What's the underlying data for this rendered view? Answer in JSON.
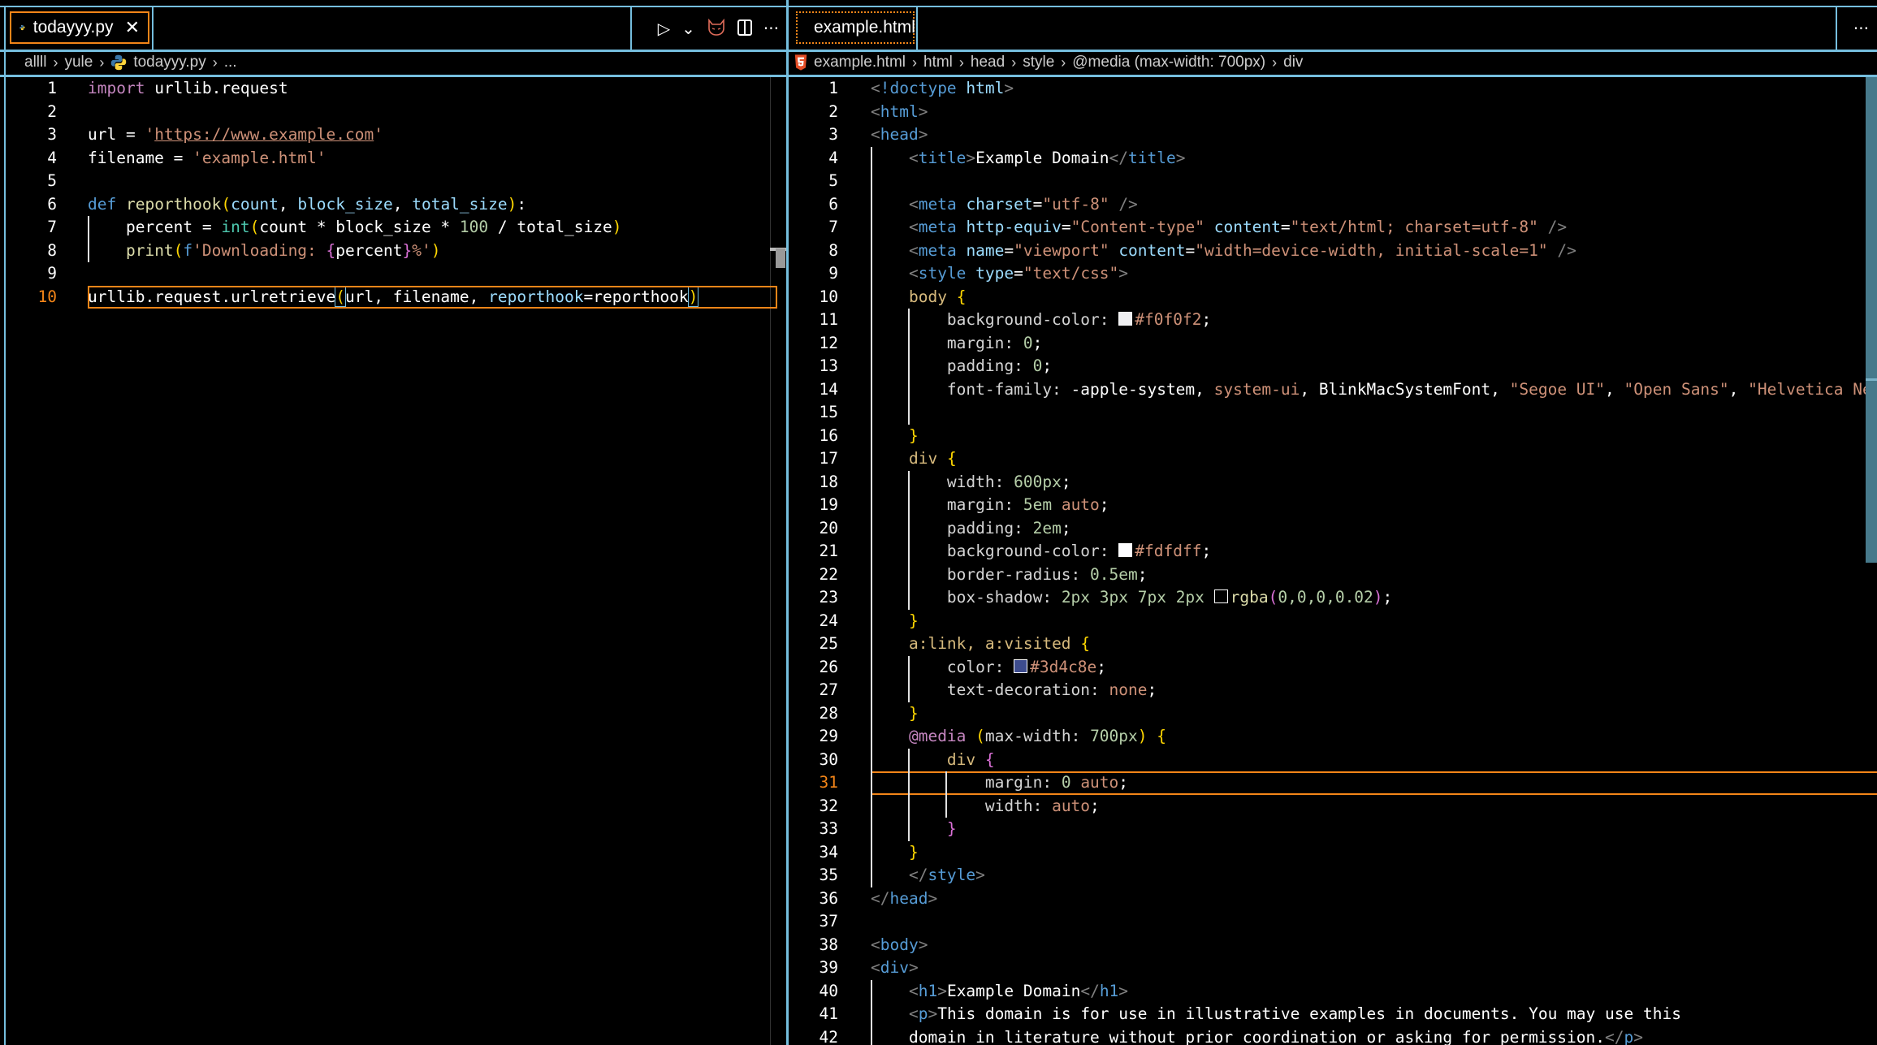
{
  "left": {
    "tab": {
      "label": "todayyy.py",
      "icon": "python-icon",
      "close": "✕"
    },
    "actions": [
      {
        "name": "run-button",
        "glyph": "▷"
      },
      {
        "name": "run-dropdown-button",
        "glyph": "⌄"
      },
      {
        "name": "copilot-button",
        "glyph": "🐱"
      },
      {
        "name": "split-editor-button",
        "glyph": "◫"
      },
      {
        "name": "more-actions-button",
        "glyph": "···"
      }
    ],
    "breadcrumb": [
      "allll",
      "yule",
      "todayyy.py",
      "..."
    ],
    "current_line": 10,
    "lines": [
      {
        "n": "1",
        "html": "<span class='kw'>import</span> <span class='w'>urllib.request</span>"
      },
      {
        "n": "2",
        "html": ""
      },
      {
        "n": "3",
        "html": "<span class='w'>url = </span><span class='str'>'<span class='u'>https://www.example.com</span>'</span>"
      },
      {
        "n": "4",
        "html": "<span class='w'>filename = </span><span class='str'>'example.html'</span>"
      },
      {
        "n": "5",
        "html": ""
      },
      {
        "n": "6",
        "html": "<span class='kb'>def</span> <span class='fn'>reporthook</span><span class='bl'>(</span><span class='var'>count</span>, <span class='var'>block_size</span>, <span class='var'>total_size</span><span class='bl'>)</span>:"
      },
      {
        "n": "7",
        "html": "    <span class='w'>percent = </span><span class='bi'>int</span><span class='bl'>(</span><span class='w'>count * block_size * </span><span class='num'>100</span><span class='w'> / total_size</span><span class='bl'>)</span>"
      },
      {
        "n": "8",
        "html": "    <span class='fn'>print</span><span class='bl'>(</span><span class='kb'>f</span><span class='str'>'Downloading: </span><span class='bp'>{</span><span class='w'>percent</span><span class='bp'>}</span><span class='str'>%'</span><span class='bl'>)</span>"
      },
      {
        "n": "9",
        "html": ""
      },
      {
        "n": "10",
        "html": "<span class='w'>urllib.request.urlretrieve</span><span class='bl bmatch'>(</span><span class='w'>url, filename, </span><span class='var'>reporthook</span><span class='w'>=reporthook</span><span class='bl bmatch'>)</span>"
      }
    ]
  },
  "right": {
    "tab": {
      "label": "example.html",
      "icon": "html5-icon",
      "dirty": true
    },
    "actions": [
      {
        "name": "more-actions-button",
        "glyph": "···"
      }
    ],
    "breadcrumb": [
      "example.html",
      "html",
      "head",
      "style",
      "@media (max-width: 700px)",
      "div"
    ],
    "current_line": 31,
    "lines": [
      {
        "n": "1",
        "html": "<span class='ang'>&lt;</span><span class='tag'>!doctype</span> <span class='attr'>html</span><span class='ang'>&gt;</span>"
      },
      {
        "n": "2",
        "html": "<span class='ang'>&lt;</span><span class='tag'>html</span><span class='ang'>&gt;</span>"
      },
      {
        "n": "3",
        "html": "<span class='ang'>&lt;</span><span class='tag'>head</span><span class='ang'>&gt;</span>"
      },
      {
        "n": "4",
        "html": "    <span class='ang'>&lt;</span><span class='tag'>title</span><span class='ang'>&gt;</span><span class='w'>Example Domain</span><span class='ang'>&lt;/</span><span class='tag'>title</span><span class='ang'>&gt;</span>"
      },
      {
        "n": "5",
        "html": ""
      },
      {
        "n": "6",
        "html": "    <span class='ang'>&lt;</span><span class='tag'>meta</span> <span class='attr'>charset</span>=<span class='str'>\"utf-8\"</span> <span class='ang'>/&gt;</span>"
      },
      {
        "n": "7",
        "html": "    <span class='ang'>&lt;</span><span class='tag'>meta</span> <span class='attr'>http-equiv</span>=<span class='str'>\"Content-type\"</span> <span class='attr'>content</span>=<span class='str'>\"text/html; charset=utf-8\"</span> <span class='ang'>/&gt;</span>"
      },
      {
        "n": "8",
        "html": "    <span class='ang'>&lt;</span><span class='tag'>meta</span> <span class='attr'>name</span>=<span class='str'>\"viewport\"</span> <span class='attr'>content</span>=<span class='str'>\"width=device-width, initial-scale=1\"</span> <span class='ang'>/&gt;</span>"
      },
      {
        "n": "9",
        "html": "    <span class='ang'>&lt;</span><span class='tag'>style</span> <span class='attr'>type</span>=<span class='str'>\"text/css\"</span><span class='ang'>&gt;</span>"
      },
      {
        "n": "10",
        "html": "    <span class='sel'>body</span> <span class='bl'>{</span>"
      },
      {
        "n": "11",
        "html": "        <span class='prop'>background-color: </span><span class='sw' style='background:#f0f0f2'></span><span class='str'>#f0f0f2</span>;"
      },
      {
        "n": "12",
        "html": "        <span class='prop'>margin: </span><span class='num'>0</span>;"
      },
      {
        "n": "13",
        "html": "        <span class='prop'>padding: </span><span class='num'>0</span>;"
      },
      {
        "n": "14",
        "html": "        <span class='prop'>font-family: </span><span class='w'>-apple-system</span>, <span class='str'>system-ui</span>, <span class='w'>BlinkMacSystemFont</span>, <span class='str'>\"Segoe UI\"</span>, <span class='str'>\"Open Sans\"</span>, <span class='str'>\"Helvetica Neue\"</span>"
      },
      {
        "n": "15",
        "html": ""
      },
      {
        "n": "16",
        "html": "    <span class='bl'>}</span>"
      },
      {
        "n": "17",
        "html": "    <span class='sel'>div</span> <span class='bl'>{</span>"
      },
      {
        "n": "18",
        "html": "        <span class='prop'>width: </span><span class='num'>600px</span>;"
      },
      {
        "n": "19",
        "html": "        <span class='prop'>margin: </span><span class='num'>5em</span> <span class='str'>auto</span>;"
      },
      {
        "n": "20",
        "html": "        <span class='prop'>padding: </span><span class='num'>2em</span>;"
      },
      {
        "n": "21",
        "html": "        <span class='prop'>background-color: </span><span class='sw' style='background:#fdfdff'></span><span class='str'>#fdfdff</span>;"
      },
      {
        "n": "22",
        "html": "        <span class='prop'>border-radius: </span><span class='num'>0.5em</span>;"
      },
      {
        "n": "23",
        "html": "        <span class='prop'>box-shadow: </span><span class='num'>2px 3px 7px 2px</span> <span class='sw' style='background:transparent'></span><span class='fn'>rgba</span><span class='bp'>(</span><span class='num'>0,0,0,0.02</span><span class='bp'>)</span>;"
      },
      {
        "n": "24",
        "html": "    <span class='bl'>}</span>"
      },
      {
        "n": "25",
        "html": "    <span class='sel'>a:link, a:visited</span> <span class='bl'>{</span>"
      },
      {
        "n": "26",
        "html": "        <span class='prop'>color: </span><span class='sw' style='background:#3d4c8e'></span><span class='str'>#3d4c8e</span>;"
      },
      {
        "n": "27",
        "html": "        <span class='prop'>text-decoration: </span><span class='str'>none</span>;"
      },
      {
        "n": "28",
        "html": "    <span class='bl'>}</span>"
      },
      {
        "n": "29",
        "html": "    <span class='kw'>@media</span> <span class='bl'>(</span><span class='prop'>max-width: </span><span class='num'>700px</span><span class='bl'>)</span> <span class='bl'>{</span>"
      },
      {
        "n": "30",
        "html": "        <span class='sel'>div</span> <span class='bp'>{</span>"
      },
      {
        "n": "31",
        "html": "            <span class='prop'>margin: </span><span class='num'>0</span> <span class='str'>auto</span>;"
      },
      {
        "n": "32",
        "html": "            <span class='prop'>width: </span><span class='str'>auto</span>;"
      },
      {
        "n": "33",
        "html": "        <span class='bp'>}</span>"
      },
      {
        "n": "34",
        "html": "    <span class='bl'>}</span>"
      },
      {
        "n": "35",
        "html": "    <span class='ang'>&lt;/</span><span class='tag'>style</span><span class='ang'>&gt;</span>"
      },
      {
        "n": "36",
        "html": "<span class='ang'>&lt;/</span><span class='tag'>head</span><span class='ang'>&gt;</span>"
      },
      {
        "n": "37",
        "html": ""
      },
      {
        "n": "38",
        "html": "<span class='ang'>&lt;</span><span class='tag'>body</span><span class='ang'>&gt;</span>"
      },
      {
        "n": "39",
        "html": "<span class='ang'>&lt;</span><span class='tag'>div</span><span class='ang'>&gt;</span>"
      },
      {
        "n": "40",
        "html": "    <span class='ang'>&lt;</span><span class='tag'>h1</span><span class='ang'>&gt;</span><span class='w'>Example Domain</span><span class='ang'>&lt;/</span><span class='tag'>h1</span><span class='ang'>&gt;</span>"
      },
      {
        "n": "41",
        "html": "    <span class='ang'>&lt;</span><span class='tag'>p</span><span class='ang'>&gt;</span><span class='w'>This domain is for use in illustrative examples in documents. You may use this</span>"
      },
      {
        "n": "42",
        "html": "    <span class='w'>domain in literature without prior coordination or asking for permission.</span><span class='ang'>&lt;/</span><span class='tag'>p</span><span class='ang'>&gt;</span>"
      }
    ]
  }
}
